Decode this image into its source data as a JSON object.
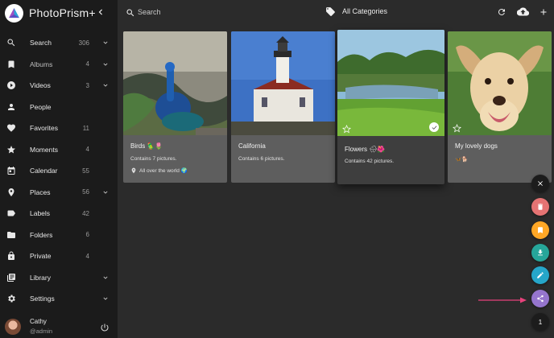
{
  "app": {
    "title": "PhotoPrism+"
  },
  "sidebar": {
    "items": [
      {
        "label": "Search",
        "count": "306",
        "icon": "search-icon",
        "chevron": true
      },
      {
        "label": "Albums",
        "count": "4",
        "icon": "bookmark-icon",
        "chevron": true
      },
      {
        "label": "Videos",
        "count": "3",
        "icon": "play-icon",
        "chevron": true
      },
      {
        "label": "People",
        "count": "",
        "icon": "person-icon",
        "chevron": false
      },
      {
        "label": "Favorites",
        "count": "11",
        "icon": "heart-icon",
        "chevron": false
      },
      {
        "label": "Moments",
        "count": "4",
        "icon": "star-icon",
        "chevron": false
      },
      {
        "label": "Calendar",
        "count": "55",
        "icon": "calendar-icon",
        "chevron": false
      },
      {
        "label": "Places",
        "count": "56",
        "icon": "place-icon",
        "chevron": true
      },
      {
        "label": "Labels",
        "count": "42",
        "icon": "label-icon",
        "chevron": false
      },
      {
        "label": "Folders",
        "count": "6",
        "icon": "folder-icon",
        "chevron": false
      },
      {
        "label": "Private",
        "count": "4",
        "icon": "lock-icon",
        "chevron": false
      },
      {
        "label": "Library",
        "count": "",
        "icon": "library-icon",
        "chevron": true
      },
      {
        "label": "Settings",
        "count": "",
        "icon": "gear-icon",
        "chevron": true
      }
    ],
    "user": {
      "name": "Cathy",
      "handle": "@admin"
    }
  },
  "toolbar": {
    "search_placeholder": "Search",
    "category_label": "All Categories"
  },
  "albums": [
    {
      "title": "Birds 🦜🌷",
      "subtitle": "Contains 7 pictures.",
      "location": "All over the world 🌍",
      "selected": false
    },
    {
      "title": "California",
      "subtitle": "Contains 6 pictures.",
      "location": "",
      "selected": false
    },
    {
      "title": "Flowers 🌧🌺",
      "subtitle": "Contains 42 pictures.",
      "location": "",
      "selected": true
    },
    {
      "title": "My lovely dogs",
      "subtitle": "🦋🐕",
      "location": "",
      "selected": false
    }
  ],
  "fab": {
    "count": "1"
  },
  "colors": {
    "sidebar_bg": "#1b1b1b",
    "content_bg": "#2b2b2b",
    "card_bg": "#5e5e5e",
    "delete": "#e57373",
    "bookmark": "#ffa726",
    "download": "#26a69a",
    "edit": "#26a6c9",
    "share": "#9575cd",
    "arrow": "#e8427c"
  }
}
